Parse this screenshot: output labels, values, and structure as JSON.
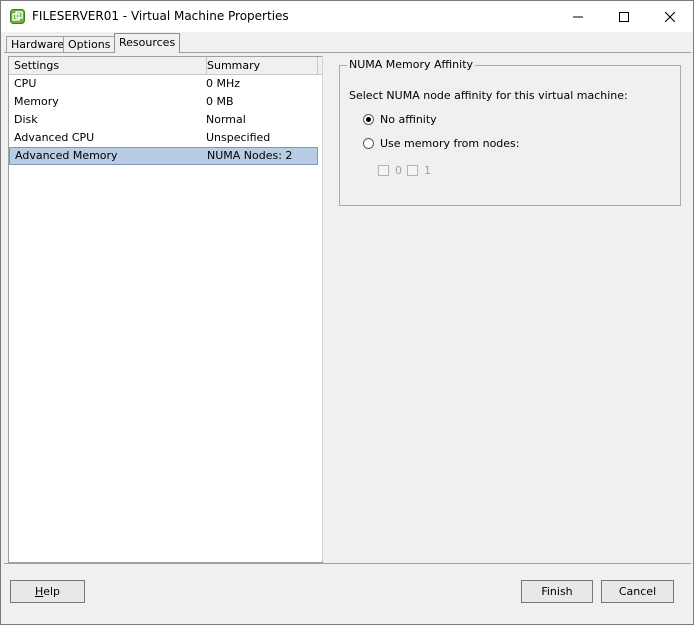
{
  "window": {
    "title": "FILESERVER01 - Virtual Machine Properties",
    "controls": {
      "minimize": "minimize",
      "maximize": "maximize",
      "close": "close"
    }
  },
  "tabs": [
    {
      "label": "Hardware",
      "active": false
    },
    {
      "label": "Options",
      "active": false
    },
    {
      "label": "Resources",
      "active": true
    }
  ],
  "list": {
    "headers": {
      "settings": "Settings",
      "summary": "Summary"
    },
    "rows": [
      {
        "setting": "CPU",
        "summary": "0 MHz"
      },
      {
        "setting": "Memory",
        "summary": "0 MB"
      },
      {
        "setting": "Disk",
        "summary": "Normal"
      },
      {
        "setting": "Advanced CPU",
        "summary": "Unspecified"
      },
      {
        "setting": "Advanced Memory",
        "summary": "NUMA Nodes: 2"
      }
    ],
    "selected_index": 4
  },
  "numa": {
    "group_title": "NUMA Memory Affinity",
    "prompt": "Select NUMA node affinity for this virtual machine:",
    "options": [
      {
        "label": "No affinity",
        "checked": true
      },
      {
        "label": "Use memory from nodes:",
        "checked": false
      }
    ],
    "nodes": [
      {
        "label": "0",
        "checked": false,
        "enabled": false
      },
      {
        "label": "1",
        "checked": false,
        "enabled": false
      }
    ]
  },
  "footer": {
    "help_first": "H",
    "help_rest": "elp",
    "finish": "Finish",
    "cancel": "Cancel"
  },
  "colors": {
    "selection_bg": "#b8cde3",
    "app_icon": "#6ab23b"
  },
  "icons": {
    "app": "vm-app-icon"
  }
}
